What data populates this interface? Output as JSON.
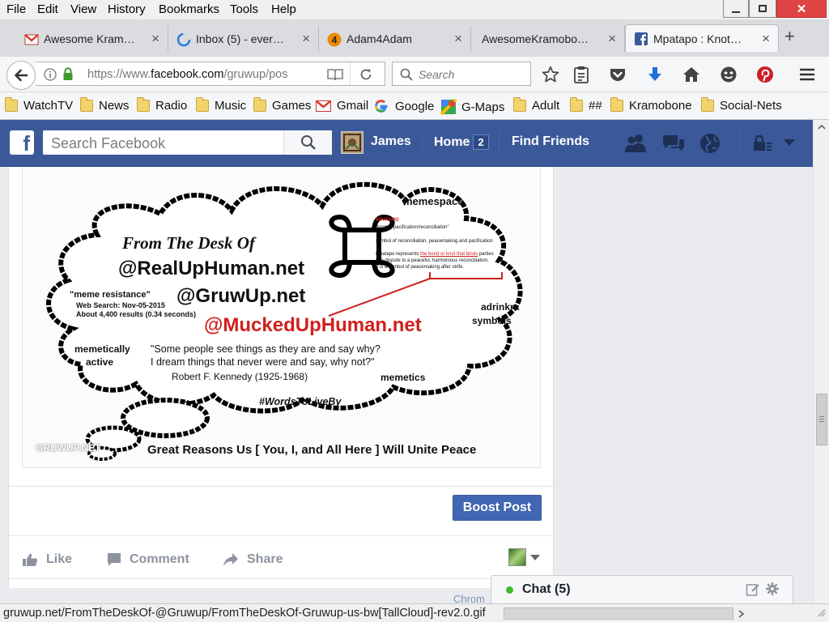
{
  "menu": [
    "File",
    "Edit",
    "View",
    "History",
    "Bookmarks",
    "Tools",
    "Help"
  ],
  "tabs": [
    {
      "title": "Awesome Kram…",
      "icon": "gmail-icon"
    },
    {
      "title": "Inbox (5) - ever…",
      "icon": "loading-icon"
    },
    {
      "title": "Adam4Adam",
      "icon": "adam4adam-icon"
    },
    {
      "title": "AwesomeKramobo…",
      "icon": ""
    },
    {
      "title": "Mpatapo : Knot…",
      "icon": "facebook-icon"
    }
  ],
  "address": {
    "prefix": "https://www.",
    "domain": "facebook.com",
    "path": "/gruwup/pos"
  },
  "search": {
    "placeholder": "Search"
  },
  "bookmarks": [
    {
      "label": "WatchTV",
      "icon": "folder"
    },
    {
      "label": "News",
      "icon": "folder"
    },
    {
      "label": "Radio",
      "icon": "folder"
    },
    {
      "label": "Music",
      "icon": "folder"
    },
    {
      "label": "Games",
      "icon": "folder"
    },
    {
      "label": "Gmail",
      "icon": "gmail"
    },
    {
      "label": "Google",
      "icon": "google"
    },
    {
      "label": "G-Maps",
      "icon": "maps"
    },
    {
      "label": "Adult",
      "icon": "folder"
    },
    {
      "label": "##",
      "icon": "folder"
    },
    {
      "label": "Kramobone",
      "icon": "folder"
    },
    {
      "label": "Social-Nets",
      "icon": "folder"
    }
  ],
  "facebook": {
    "search_placeholder": "Search Facebook",
    "user": "James",
    "home": "Home",
    "home_badge": "2",
    "find_friends": "Find Friends"
  },
  "post_image": {
    "memespace": "memespace",
    "from_desk": "From The Desk Of",
    "handle1": "@RealUpHuman.net",
    "handle2": "@GruwUp.net",
    "handle3": "@MuckedUpHuman.net",
    "meme_resistance": "\"meme resistance\"",
    "web_search": "Web Search: Nov-05-2015",
    "results": "About 4,400 results (0.34 seconds)",
    "memetically": "memetically",
    "active": "active",
    "quote1": "\"Some people see things as they are and say why?",
    "quote2": "I dream things that never were and say, why not?\"",
    "quote_author": "Robert F. Kennedy (1925-1968)",
    "memetics": "memetics",
    "adrinkra": "adrinkra",
    "symbols": "symbols",
    "hashtag": "#WordsToLiveBy",
    "watermark": "GRUWUP.NET",
    "tagline": "Great Reasons Us [ You, I, and All Here ] Will Unite Peace",
    "mpatapo_title": "MPATAPO",
    "mpatapo_sub": "\"knot of pacification/reconciliation\"",
    "mpatapo_l1": "symbol of reconciliation, peacemaking and pacification",
    "mpatapo_l2a": "Mpatapo represents ",
    "mpatapo_l2b": "the bond or knot that binds",
    "mpatapo_l2c": " parties",
    "mpatapo_l3": "in a dispute to a peaceful, harmonious reconciliation.",
    "mpatapo_l4": "It is a symbol of peacemaking after strife."
  },
  "actions": {
    "boost": "Boost Post",
    "like": "Like",
    "comment": "Comment",
    "share": "Share"
  },
  "chat": {
    "label": "Chat (5)"
  },
  "status_url": "gruwup.net/FromTheDeskOf-@Gruwup/FromTheDeskOf-Gruwup-us-bw[TallCloud]-rev2.0.gif",
  "ghost_text": "Chrom",
  "colors": {
    "fb_blue": "#3b5998",
    "boost_blue": "#4267b2",
    "link_red": "#d0201e"
  }
}
